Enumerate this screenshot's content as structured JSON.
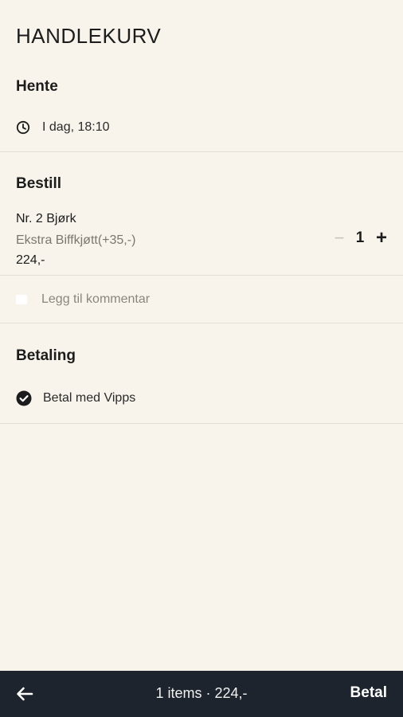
{
  "page": {
    "title": "HANDLEKURV"
  },
  "pickup": {
    "heading": "Hente",
    "time_text": "I dag, 18:10",
    "icon": "clock-icon"
  },
  "order": {
    "heading": "Bestill",
    "items": [
      {
        "name": "Nr. 2 Bjørk",
        "extra": "Ekstra Biffkjøtt(+35,-)",
        "price": "224,-",
        "quantity": "1"
      }
    ],
    "stepper": {
      "minus": "−",
      "plus": "+"
    },
    "comment_label": "Legg til kommentar"
  },
  "payment": {
    "heading": "Betaling",
    "method": "Betal med Vipps",
    "icon": "check-circle-icon"
  },
  "bottom_bar": {
    "summary": "1 items · 224,-",
    "pay_label": "Betal",
    "back_icon": "arrow-left-icon",
    "background": "#1d242d"
  },
  "colors": {
    "background": "#f8f4ec",
    "divider": "#e4ded2",
    "muted_text": "#7b776f"
  }
}
